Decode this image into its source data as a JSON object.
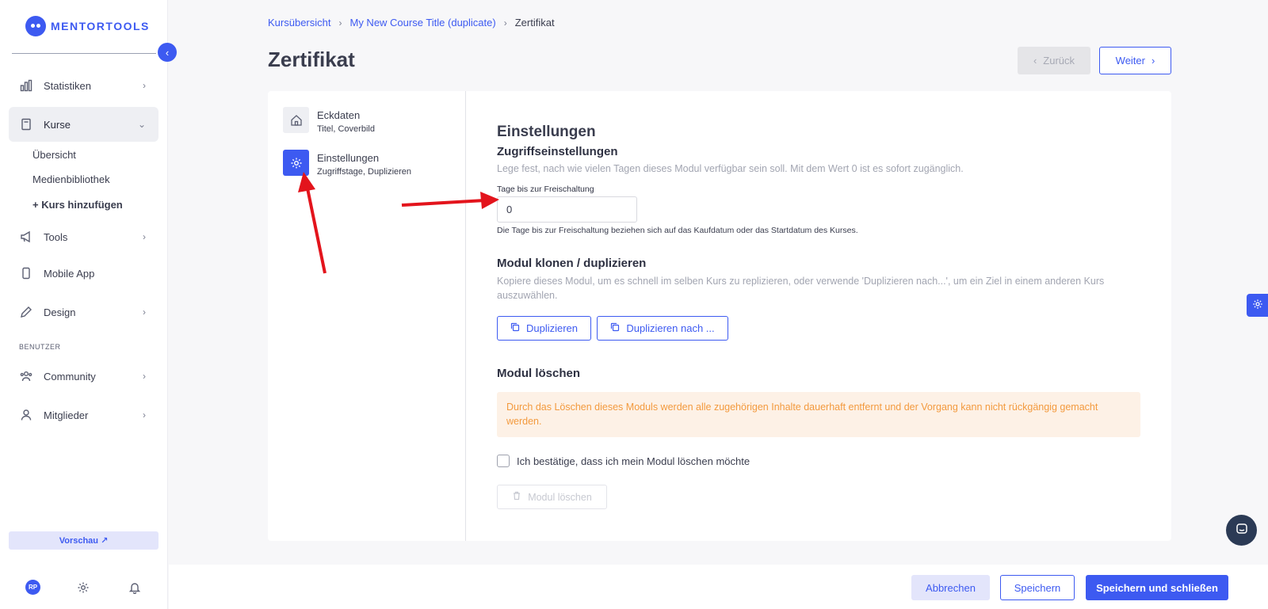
{
  "app": {
    "logo_text": "MENTORTOOLS",
    "accent": "#3d5af1"
  },
  "sidebar": {
    "items": [
      {
        "label": "Statistiken",
        "icon": "bar-chart-icon"
      },
      {
        "label": "Kurse",
        "icon": "book-icon"
      },
      {
        "label": "Tools",
        "icon": "megaphone-icon"
      },
      {
        "label": "Mobile App",
        "icon": "phone-icon"
      },
      {
        "label": "Design",
        "icon": "pen-icon"
      },
      {
        "label": "Community",
        "icon": "users-icon"
      },
      {
        "label": "Mitglieder",
        "icon": "user-icon"
      }
    ],
    "sub_items": [
      "Übersicht",
      "Medienbibliothek",
      "+ Kurs hinzufügen"
    ],
    "section_label": "BENUTZER",
    "preview_label": "Vorschau ↗",
    "avatar_initials": "RP"
  },
  "breadcrumb": [
    "Kursübersicht",
    "My New Course Title (duplicate)",
    "Zertifikat"
  ],
  "page_title": "Zertifikat",
  "nav_buttons": {
    "back": "Zurück",
    "next": "Weiter"
  },
  "steps": [
    {
      "title": "Eckdaten",
      "subtitle": "Titel, Coverbild",
      "icon": "home-icon"
    },
    {
      "title": "Einstellungen",
      "subtitle": "Zugriffstage, Duplizieren",
      "icon": "gear-icon"
    }
  ],
  "settings": {
    "heading": "Einstellungen",
    "access": {
      "heading": "Zugriffseinstellungen",
      "description": "Lege fest, nach wie vielen Tagen dieses Modul verfügbar sein soll. Mit dem Wert 0 ist es sofort zugänglich.",
      "field_label": "Tage bis zur Freischaltung",
      "field_value": "0",
      "hint": "Die Tage bis zur Freischaltung beziehen sich auf das Kaufdatum oder das Startdatum des Kurses."
    },
    "clone": {
      "heading": "Modul klonen / duplizieren",
      "description": "Kopiere dieses Modul, um es schnell im selben Kurs zu replizieren, oder verwende 'Duplizieren nach...', um ein Ziel in einem anderen Kurs auszuwählen.",
      "duplicate_label": "Duplizieren",
      "duplicate_to_label": "Duplizieren nach ..."
    },
    "delete": {
      "heading": "Modul löschen",
      "warning": "Durch das Löschen dieses Moduls werden alle zugehörigen Inhalte dauerhaft entfernt und der Vorgang kann nicht rückgängig gemacht werden.",
      "confirm_label": "Ich bestätige, dass ich mein Modul löschen möchte",
      "delete_label": "Modul löschen"
    }
  },
  "footer_buttons": {
    "cancel": "Abbrechen",
    "save": "Speichern",
    "save_close": "Speichern und schließen"
  }
}
